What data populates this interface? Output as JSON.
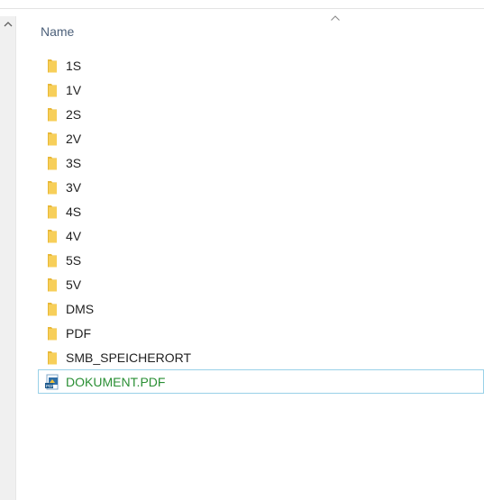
{
  "header": {
    "name_column": "Name"
  },
  "files": [
    {
      "label": "1S",
      "icon": "folder-icon"
    },
    {
      "label": "1V",
      "icon": "folder-icon"
    },
    {
      "label": "2S",
      "icon": "folder-icon"
    },
    {
      "label": "2V",
      "icon": "folder-icon"
    },
    {
      "label": "3S",
      "icon": "folder-icon"
    },
    {
      "label": "3V",
      "icon": "folder-icon"
    },
    {
      "label": "4S",
      "icon": "folder-icon"
    },
    {
      "label": "4V",
      "icon": "folder-icon"
    },
    {
      "label": "5S",
      "icon": "folder-icon"
    },
    {
      "label": "5V",
      "icon": "folder-icon"
    },
    {
      "label": "DMS",
      "icon": "folder-icon"
    },
    {
      "label": "PDF",
      "icon": "folder-icon"
    },
    {
      "label": "SMB_SPEICHERORT",
      "icon": "folder-icon"
    },
    {
      "label": "DOKUMENT.PDF",
      "icon": "pdf-file-icon",
      "selected": true
    }
  ],
  "colors": {
    "folder": "#f5c84c",
    "selection_border": "#99d1e8",
    "selected_text": "#2a8f34",
    "header_text": "#4c607a"
  }
}
